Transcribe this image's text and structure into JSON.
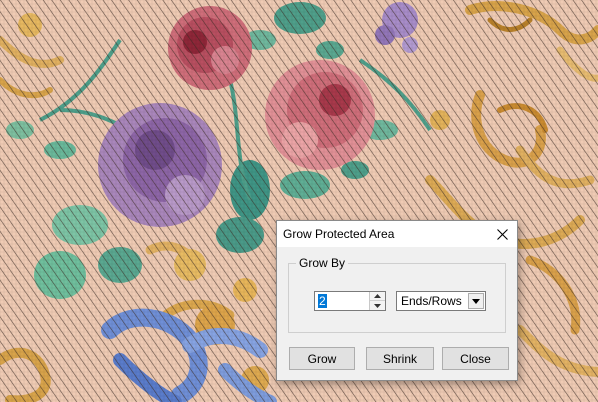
{
  "dialog": {
    "title": "Grow Protected Area",
    "group_label": "Grow By",
    "amount_value": "2",
    "unit_selected": "Ends/Rows",
    "buttons": {
      "grow": "Grow",
      "shrink": "Shrink",
      "close": "Close"
    }
  },
  "icons": {
    "close": "close-icon",
    "spin_up": "chevron-up-icon",
    "spin_down": "chevron-down-icon",
    "dropdown": "dropdown-arrow-icon"
  },
  "colors": {
    "background": "#efcbb4",
    "selection": "#0078d7",
    "dialog_bg": "#f0f0f0"
  }
}
